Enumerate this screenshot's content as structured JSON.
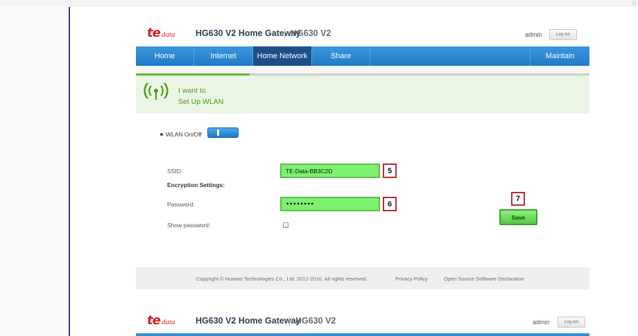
{
  "browser": {
    "corner_icon": "☆"
  },
  "header": {
    "logo_mark": "te",
    "logo_data": "data",
    "title": "HG630 V2 Home Gateway",
    "model": "HG630 V2",
    "user": "admin",
    "logout_label": "Log out"
  },
  "nav": {
    "items": [
      {
        "label": "Home",
        "active": false
      },
      {
        "label": "Internet",
        "active": false
      },
      {
        "label": "Home Network",
        "active": true
      },
      {
        "label": "Share",
        "active": false
      }
    ],
    "maintain_label": "Maintain"
  },
  "wizard": {
    "progress": 0.25
  },
  "banner": {
    "line1": "I want to",
    "line2": "Set Up WLAN",
    "icon": "wifi-signal-icon"
  },
  "form": {
    "wlan_label": "WLAN On/Off",
    "wlan_on": true,
    "ssid_label": "SSID:",
    "ssid_value": "TE-Data-BB3C2D",
    "encryption_heading": "Encryption Settings:",
    "password_label": "Password:",
    "password_value": "••••••••",
    "show_password_label": "Show password:",
    "show_password_checked": false,
    "save_label": "Save"
  },
  "annotations": {
    "ssid_step": "5",
    "password_step": "6",
    "save_step": "7"
  },
  "footer": {
    "copyright": "Copyright © Huawei Technologies Co., Ltd. 2012-2016. All rights reserved.",
    "privacy": "Privacy Policy",
    "oss": "Open Source Software Declaration"
  },
  "colors": {
    "brand_red": "#d21f26",
    "nav_blue": "#1f7ac9",
    "nav_active": "#1d4f86",
    "highlight_green": "#7cf16f",
    "marker_red": "#c0272d",
    "banner_green": "#4a9a16"
  }
}
